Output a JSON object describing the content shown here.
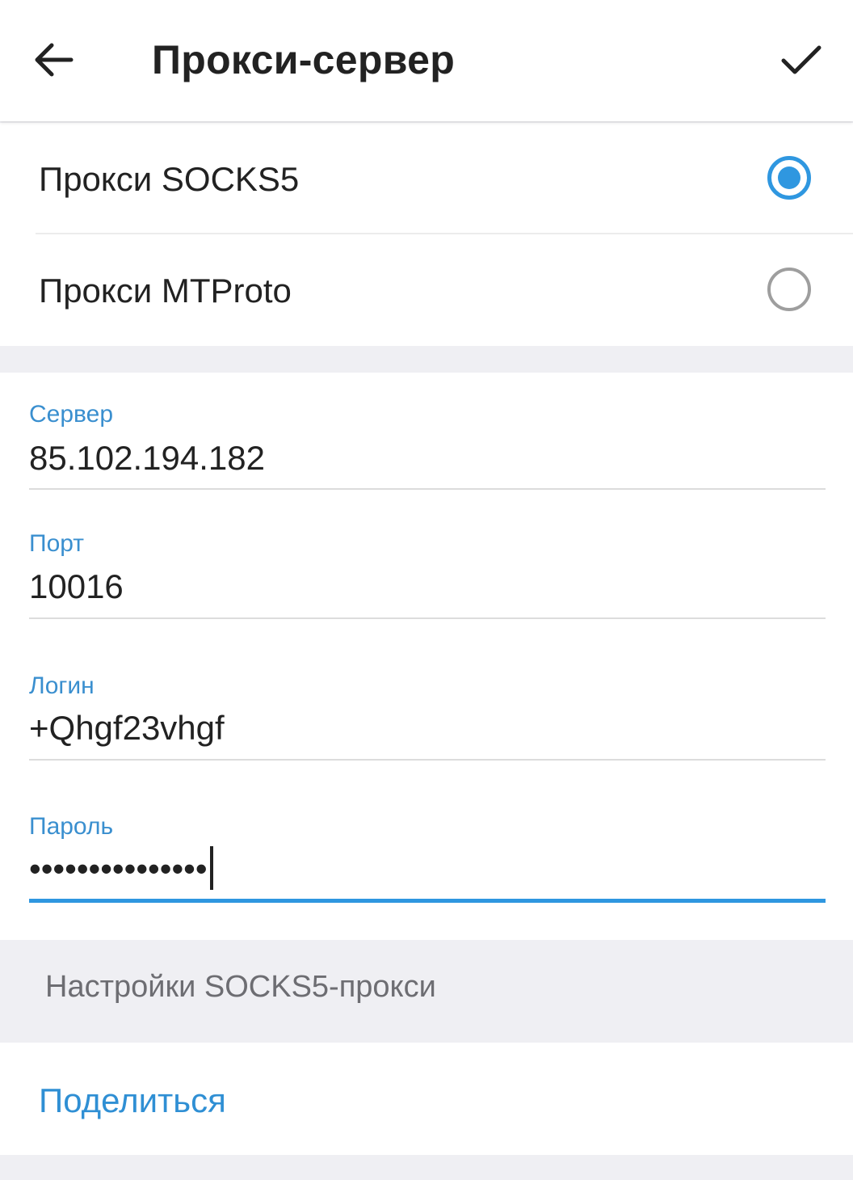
{
  "header": {
    "title": "Прокси-сервер",
    "back_icon": "arrow-left-icon",
    "done_icon": "checkmark-icon"
  },
  "proxy_types": {
    "socks5": {
      "label": "Прокси SOCKS5",
      "selected": true
    },
    "mtproto": {
      "label": "Прокси MTProto",
      "selected": false
    }
  },
  "fields": {
    "server": {
      "label": "Сервер",
      "value": "85.102.194.182"
    },
    "port": {
      "label": "Порт",
      "value": "10016"
    },
    "login": {
      "label": "Логин",
      "value": "+Qhgf23vhgf"
    },
    "password": {
      "label": "Пароль",
      "value": "•••••••••••••••"
    }
  },
  "info": {
    "text": "Настройки SOCKS5-прокси"
  },
  "actions": {
    "share_label": "Поделиться"
  },
  "colors": {
    "accent": "#2f97e0",
    "label_blue": "#3a8fcf",
    "text_primary": "#222222",
    "text_secondary": "#6d6d72",
    "background_gray": "#efeff3"
  }
}
